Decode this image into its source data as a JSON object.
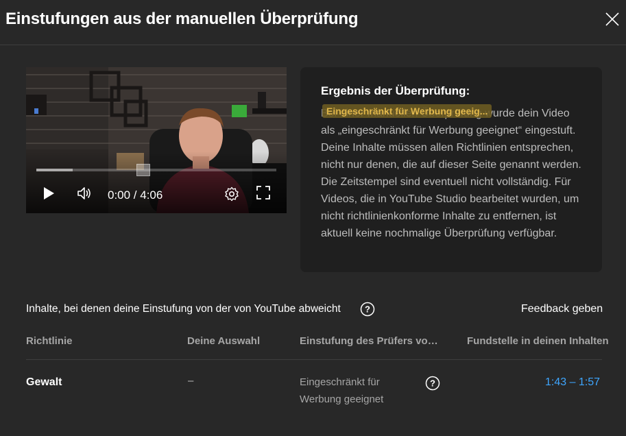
{
  "dialog": {
    "title": "Einstufungen aus der manuellen Überprüfung",
    "close_icon": "close-icon"
  },
  "player": {
    "time": "0:00 / 4:06",
    "buffered_fraction": 0.15,
    "icons": [
      "play-icon",
      "volume-icon",
      "settings-icon",
      "fullscreen-icon"
    ]
  },
  "result": {
    "heading": "Ergebnis der Überprüfung:",
    "badge": "Eingeschränkt für Werbung geeig...",
    "text": "Bei einer manuellen Überprüfung wurde dein Video als „eingeschränkt für Werbung geeignet“ eingestuft. Deine Inhalte müssen allen Richtlinien entsprechen, nicht nur denen, die auf dieser Seite genannt werden. Die Zeitstempel sind eventuell nicht vollständig. Für Videos, die in YouTube Studio bearbeitet wurden, um nicht richtlinienkonforme Inhalte zu entfernen, ist aktuell keine nochmalige Überprüfung verfügbar."
  },
  "section": {
    "title": "Inhalte, bei denen deine Einstufung von der von YouTube abweicht",
    "feedback": "Feedback geben"
  },
  "table": {
    "headers": [
      "Richtlinie",
      "Deine Auswahl",
      "Einstufung des Prüfers von ...",
      "Fundstelle in deinen Inhalten"
    ],
    "rows": [
      {
        "policy": "Gewalt",
        "your_choice": "–",
        "reviewer": "Eingeschränkt für Werbung geeignet",
        "location": "1:43 – 1:57"
      }
    ]
  },
  "colors": {
    "background": "#282828",
    "card": "#1f1f1f",
    "link": "#3ea6ff",
    "badge": "#f0c24b"
  }
}
